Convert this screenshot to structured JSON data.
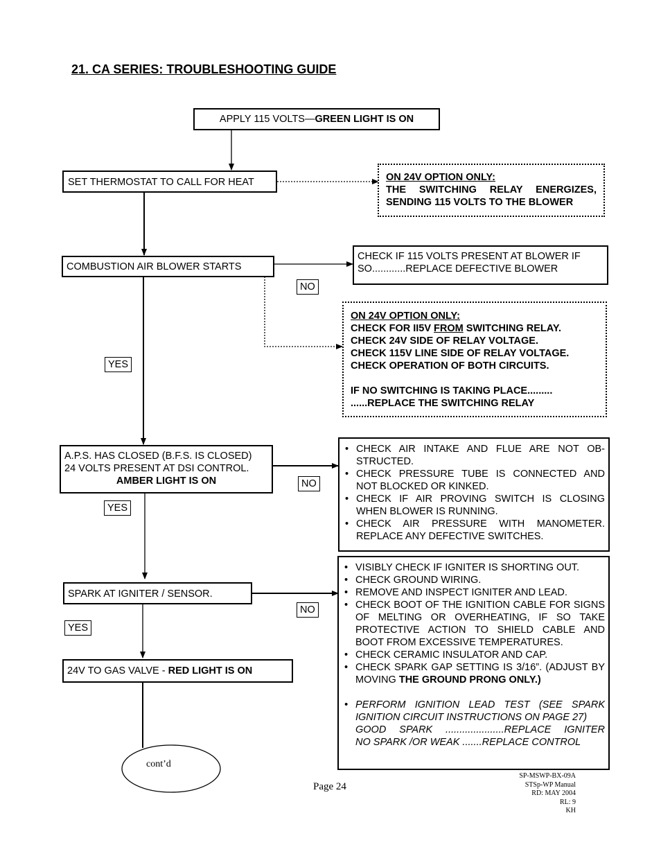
{
  "page_title": "21. CA SERIES:  TROUBLESHOOTING GUIDE",
  "flow": {
    "start": {
      "normal": "APPLY 115 VOLTS—",
      "bold": "GREEN LIGHT IS ON"
    },
    "thermostat": "SET THERMOSTAT TO CALL FOR HEAT",
    "note_24v_1": {
      "heading": "ON 24V OPTION ONLY:",
      "line1": "THE  SWITCHING  RELAY  ENERGIZES,",
      "line2": "SENDING 115 VOLTS TO THE BLOWER"
    },
    "blower": "COMBUSTION AIR BLOWER STARTS",
    "blower_no_action": "CHECK IF 115 VOLTS PRESENT AT BLOWER IF SO............REPLACE DEFECTIVE BLOWER",
    "note_24v_2": {
      "heading": "ON 24V OPTION ONLY:",
      "line1_pre": "CHECK FOR II5V ",
      "line1_u": "FROM",
      "line1_post": " SWITCHING RELAY.",
      "line2": "CHECK 24V SIDE OF RELAY  VOLTAGE.",
      "line3": "CHECK 115V LINE SIDE OF RELAY VOLTAGE.",
      "line4": "CHECK OPERATION OF BOTH CIRCUITS.",
      "line5": "IF NO SWITCHING IS TAKING PLACE.........",
      "line6": "......REPLACE THE SWITCHING RELAY"
    },
    "aps": {
      "line1": "A.P.S. HAS CLOSED (B.F.S. IS CLOSED)",
      "line2": "24 VOLTS PRESENT AT DSI CONTROL.",
      "line3": "AMBER LIGHT IS ON"
    },
    "aps_no_actions": [
      "CHECK AIR INTAKE AND FLUE ARE NOT  OB-STRUCTED.",
      "CHECK PRESSURE TUBE IS CONNECTED AND NOT BLOCKED OR KINKED.",
      "CHECK IF AIR PROVING SWITCH IS CLOSING WHEN BLOWER IS RUNNING.",
      "CHECK AIR PRESSURE WITH MANOMETER. REPLACE ANY DEFECTIVE SWITCHES."
    ],
    "spark": "SPARK AT IGNITER / SENSOR.",
    "spark_no_actions": [
      "VISIBLY CHECK IF IGNITER IS SHORTING OUT.",
      "CHECK GROUND WIRING.",
      "REMOVE AND INSPECT IGNITER AND LEAD.",
      "CHECK BOOT OF THE IGNITION CABLE FOR SIGNS OF MELTING OR OVERHEATING, IF SO TAKE PROTECTIVE ACTION TO SHIELD CABLE AND BOOT FROM EXCESSIVE TEMPERATURES.",
      "CHECK CERAMIC INSULATOR AND CAP."
    ],
    "spark_gap": {
      "normal": "CHECK SPARK GAP SETTING IS 3/16”.  (ADJUST BY MOVING ",
      "bold": "THE GROUND PRONG ONLY.)"
    },
    "lead_test": {
      "line1": "PERFORM IGNITION LEAD TEST (SEE SPARK IGNITION CIRCUIT INSTRUCTIONS ON PAGE 27)",
      "line2": "GOOD  SPARK  .....................REPLACE  IGNITER",
      "line3": "NO SPARK /OR WEAK .......REPLACE CONTROL"
    },
    "gas_valve": {
      "normal": "24V  TO GAS VALVE -  ",
      "bold": "RED LIGHT IS ON"
    },
    "continued": "cont’d",
    "labels": {
      "yes": "YES",
      "no": "NO"
    }
  },
  "footer": {
    "page": "Page 24",
    "doc_lines": [
      "SP-MSWP-BX-09A",
      "STSp-WP Manual",
      "RD: MAY 2004",
      "RL: 9",
      "KH"
    ]
  }
}
